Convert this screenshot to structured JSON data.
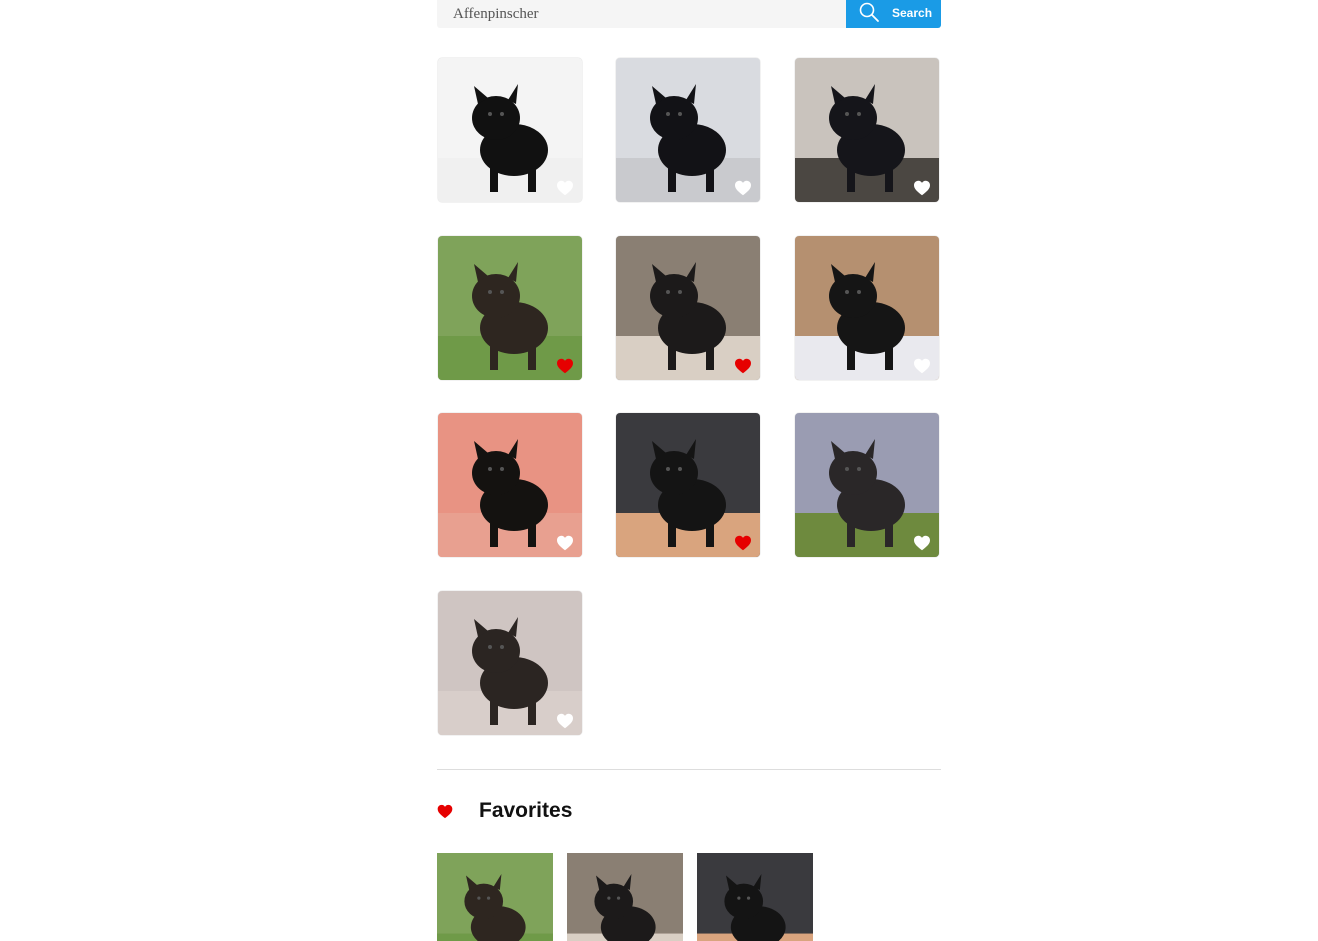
{
  "search": {
    "value": "Affenpinscher",
    "placeholder": "Affenpinscher",
    "button_label": "Search",
    "icon": "search-icon"
  },
  "gallery": {
    "items": [
      {
        "favorited": false,
        "bg": "#f4f4f4",
        "dog": "#111111",
        "ground": "#f0f0f0"
      },
      {
        "favorited": false,
        "bg": "#d9dbe0",
        "dog": "#121216",
        "ground": "#c9cace"
      },
      {
        "favorited": false,
        "bg": "#c9c3bd",
        "dog": "#15151a",
        "ground": "#4b4742"
      },
      {
        "favorited": true,
        "bg": "#7fa35a",
        "dog": "#2e2620",
        "ground": "#6f9a48"
      },
      {
        "favorited": true,
        "bg": "#8a7f73",
        "dog": "#1c1a1a",
        "ground": "#d9cfc4"
      },
      {
        "favorited": false,
        "bg": "#b59070",
        "dog": "#151515",
        "ground": "#e9e9ee"
      },
      {
        "favorited": false,
        "bg": "#e89383",
        "dog": "#141210",
        "ground": "#e8a090"
      },
      {
        "favorited": true,
        "bg": "#3a3a3e",
        "dog": "#141414",
        "ground": "#d9a47e"
      },
      {
        "favorited": false,
        "bg": "#9a9cb2",
        "dog": "#2a2728",
        "ground": "#6e8a3e"
      },
      {
        "favorited": false,
        "bg": "#cfc5c2",
        "dog": "#2b2522",
        "ground": "#d8ceca"
      }
    ],
    "heart_icon": "heart-icon",
    "colors": {
      "heart_on": "#e60000",
      "heart_off": "#ffffff"
    }
  },
  "favorites": {
    "title": "Favorites",
    "icon": "heart-icon",
    "items": [
      {
        "bg": "#7fa35a",
        "dog": "#2e2620",
        "ground": "#6f9a48"
      },
      {
        "bg": "#8a7f73",
        "dog": "#1c1a1a",
        "ground": "#d9cfc4"
      },
      {
        "bg": "#3a3a3e",
        "dog": "#141414",
        "ground": "#d9a47e"
      }
    ]
  },
  "colors": {
    "accent": "#1a9be6",
    "divider": "#dddddd"
  }
}
